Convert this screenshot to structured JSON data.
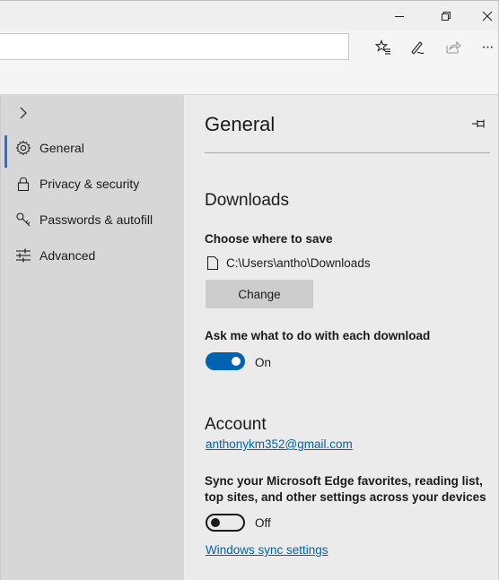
{
  "toolbar": {
    "favorites_icon": "favorites-star-icon",
    "notes_icon": "pen-icon",
    "share_icon": "share-icon",
    "more_label": "···"
  },
  "sidebar": {
    "items": [
      {
        "label": "General",
        "icon": "gear-icon",
        "active": true
      },
      {
        "label": "Privacy & security",
        "icon": "lock-icon"
      },
      {
        "label": "Passwords & autofill",
        "icon": "key-icon"
      },
      {
        "label": "Advanced",
        "icon": "sliders-icon"
      }
    ]
  },
  "panel": {
    "title": "General",
    "downloads": {
      "heading": "Downloads",
      "choose_label": "Choose where to save",
      "path": "C:\\Users\\antho\\Downloads",
      "change_button": "Change",
      "ask_label": "Ask me what to do with each download",
      "ask_state": "On"
    },
    "account": {
      "heading": "Account",
      "email": "anthonykm352@gmail.com",
      "sync_label": "Sync your Microsoft Edge favorites, reading list, top sites, and other settings across your devices",
      "sync_state": "Off",
      "sync_link": "Windows sync settings"
    }
  },
  "colors": {
    "accent": "#0063b1",
    "active_indicator": "#2b6fd6"
  }
}
